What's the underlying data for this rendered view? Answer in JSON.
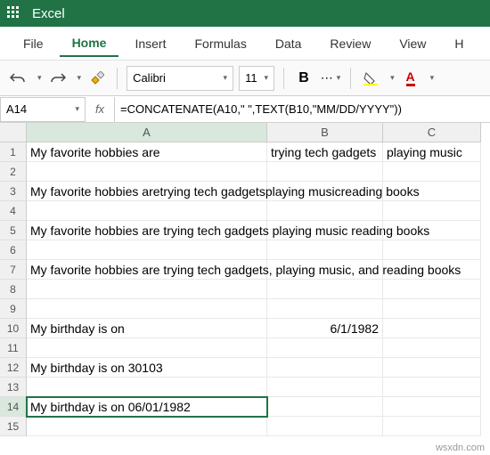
{
  "app_name": "Excel",
  "tabs": {
    "file": "File",
    "home": "Home",
    "insert": "Insert",
    "formulas": "Formulas",
    "data": "Data",
    "review": "Review",
    "view": "View",
    "last": "H"
  },
  "font": {
    "name": "Calibri",
    "size": "11"
  },
  "name_box": "A14",
  "fx_label": "fx",
  "formula": "=CONCATENATE(A10,\" \",TEXT(B10,\"MM/DD/YYYY\"))",
  "cols": {
    "A": "A",
    "B": "B",
    "C": "C"
  },
  "rows": {
    "r1": {
      "A": "My favorite hobbies are",
      "B": "trying tech gadgets",
      "C": "playing music"
    },
    "r3": {
      "A": "My favorite hobbies aretrying tech gadgetsplaying musicreading books"
    },
    "r5": {
      "A": "My favorite hobbies are trying tech gadgets playing music reading books"
    },
    "r7": {
      "A": "My favorite hobbies are trying tech gadgets, playing music, and reading books"
    },
    "r10": {
      "A": "My birthday is on",
      "B": "6/1/1982"
    },
    "r12": {
      "A": "My birthday is on 30103"
    },
    "r14": {
      "A": "My birthday is on 06/01/1982"
    }
  },
  "watermark": "wsxdn.com"
}
